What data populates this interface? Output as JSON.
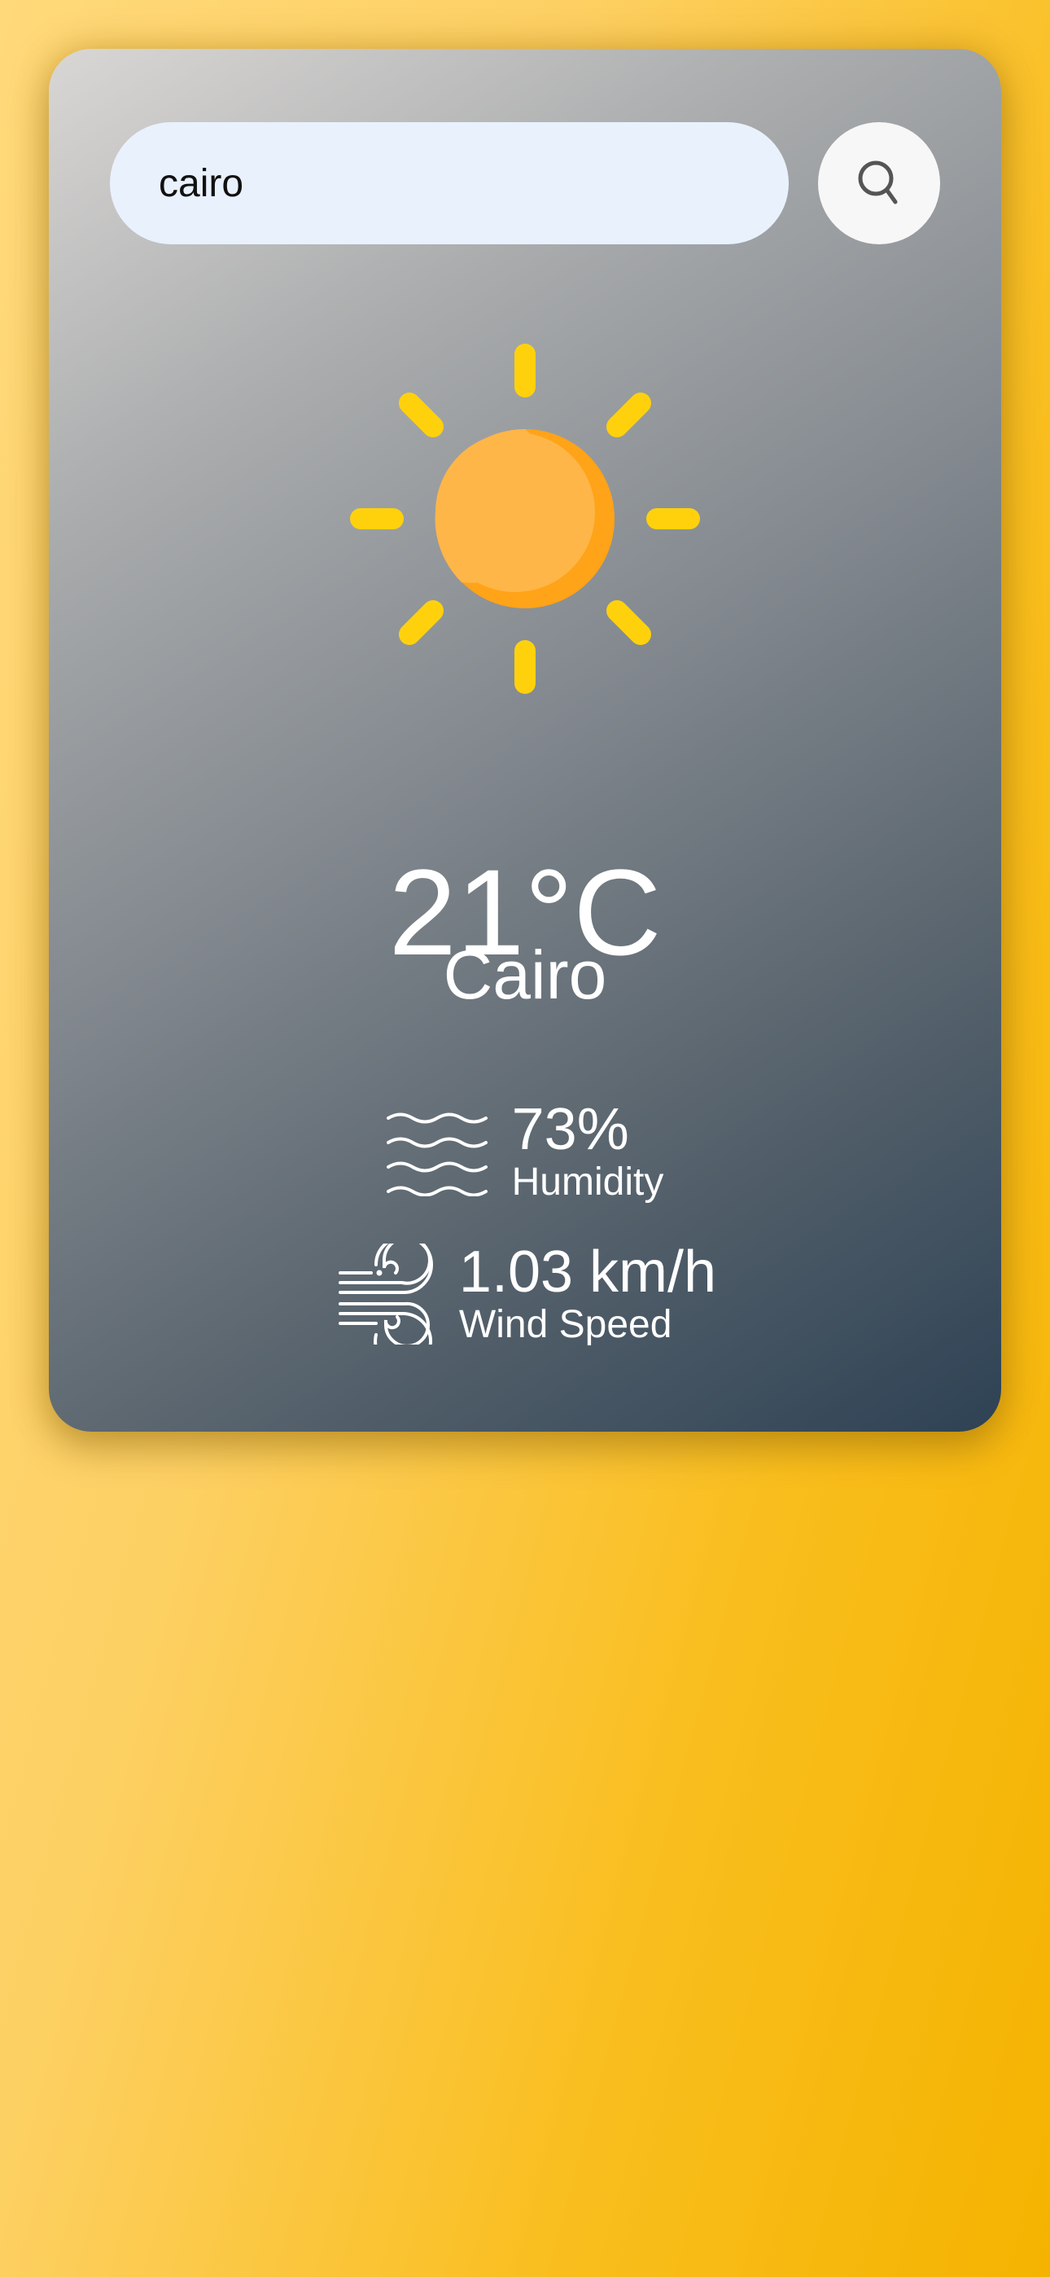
{
  "search": {
    "value": "cairo",
    "button_icon": "search-icon"
  },
  "weather": {
    "icon": "sun-icon",
    "temperature": "21°C",
    "city": "Cairo"
  },
  "details": {
    "humidity": {
      "icon": "humidity-waves-icon",
      "value": "73%",
      "label": "Humidity"
    },
    "wind": {
      "icon": "wind-icon",
      "value": "1.03 km/h",
      "label": "Wind Speed"
    }
  },
  "colors": {
    "sun_ray": "#ffd10d",
    "sun_body": "#ffb648",
    "sun_shadow": "#ffa318",
    "input_bg": "#e9f1fd"
  }
}
